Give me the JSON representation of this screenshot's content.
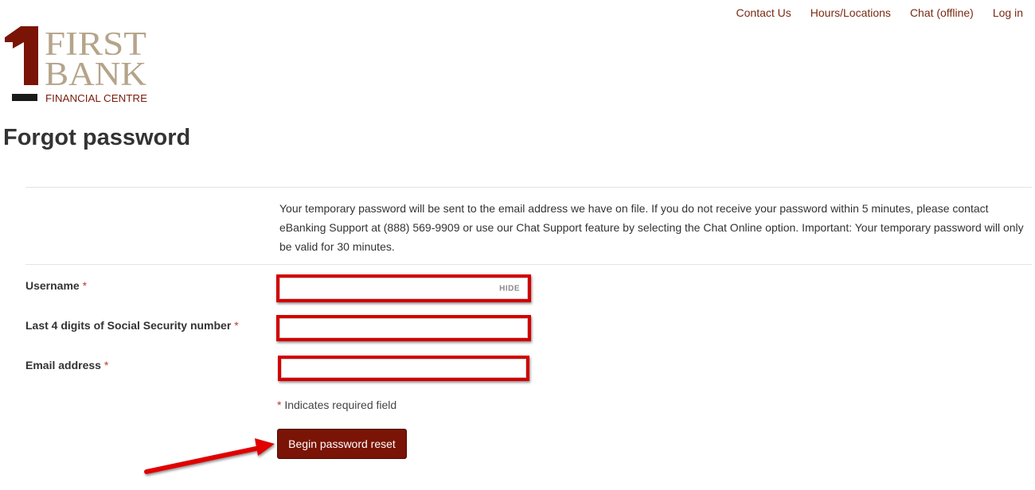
{
  "nav": {
    "contact": "Contact Us",
    "hours": "Hours/Locations",
    "chat": "Chat (offline)",
    "login": "Log in"
  },
  "logo": {
    "line1": "FIRST",
    "line2": "BANK",
    "line3": "FINANCIAL CENTRE"
  },
  "page": {
    "title": "Forgot password",
    "notice": "Your temporary password will be sent to the email address we have on file. If you do not receive your password within 5 minutes, please contact eBanking Support at (888) 569-9909 or use our Chat Support feature by selecting the Chat Online option. Important: Your temporary password will only be valid for 30 minutes."
  },
  "form": {
    "username_label": "Username",
    "ssn_label": "Last 4 digits of Social Security number",
    "email_label": "Email address",
    "required_mark": "*",
    "hide_label": "HIDE",
    "username_value": "",
    "ssn_value": "",
    "email_value": "",
    "required_note": "Indicates required field",
    "submit_label": "Begin password reset"
  },
  "colors": {
    "brand": "#7a1406",
    "link": "#7a2a12",
    "highlight": "#d40000"
  }
}
